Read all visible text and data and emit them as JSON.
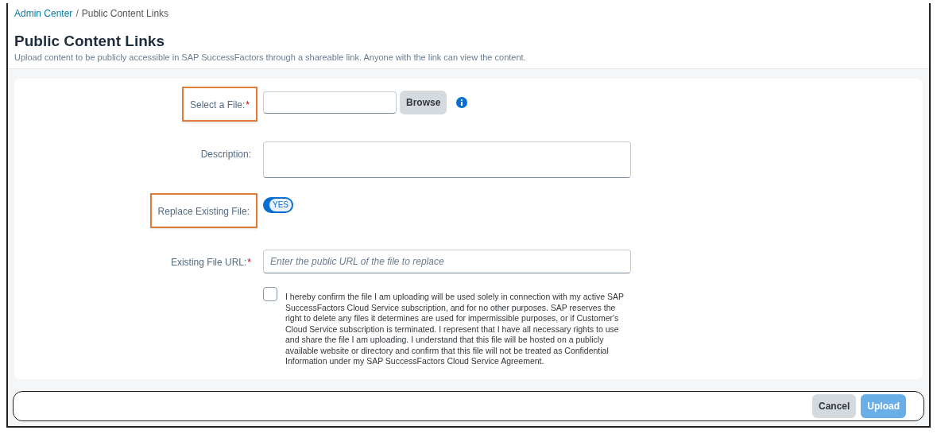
{
  "breadcrumb": {
    "link": "Admin Center",
    "separator": "/",
    "current": "Public Content Links"
  },
  "page": {
    "title": "Public Content Links",
    "subtitle": "Upload content to be publicly accessible in SAP SuccessFactors through a shareable link. Anyone with the link can view the content."
  },
  "form": [
    {
      "kind": "file",
      "label": "Select a File:",
      "required_mark": "*",
      "highlighted": true,
      "button": "Browse"
    },
    {
      "kind": "textarea",
      "label": "Description:",
      "highlighted": false
    },
    {
      "kind": "toggle",
      "label": "Replace Existing File:",
      "highlighted": true,
      "on": true,
      "toggle_text": "YES"
    },
    {
      "kind": "text",
      "label": "Existing File URL:",
      "required_mark": "*",
      "highlighted": false,
      "placeholder": "Enter the public URL of the file to replace"
    }
  ],
  "agreement": {
    "checked": false,
    "text": "I hereby confirm the file I am uploading will be used solely in connection with my active SAP SuccessFactors Cloud Service subscription, and for no other purposes. SAP reserves the right to delete any files it determines are used for impermissible purposes, or if Customer's Cloud Service subscription is terminated. I represent that I have all necessary rights to use and share the file I am uploading. I understand that this file will be hosted on a publicly available website or directory and confirm that this file will not be treated as Confidential Information under my SAP SuccessFactors Cloud Service Agreement."
  },
  "footer": {
    "buttons": [
      {
        "label": "Cancel",
        "disabled": false
      },
      {
        "label": "Upload",
        "disabled": true
      }
    ]
  }
}
